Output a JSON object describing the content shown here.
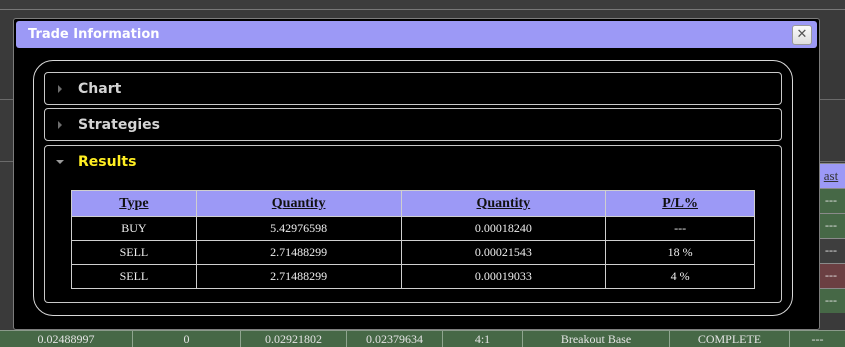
{
  "dialog": {
    "title": "Trade Information",
    "close_glyph": "✕"
  },
  "sections": {
    "chart": "Chart",
    "strategies": "Strategies",
    "results": "Results"
  },
  "results_table": {
    "headers": [
      "Type",
      "Quantity",
      "Quantity",
      "P/L%"
    ],
    "rows": [
      [
        "BUY",
        "5.42976598",
        "0.00018240",
        "---"
      ],
      [
        "SELL",
        "2.71488299",
        "0.00021543",
        "18 %"
      ],
      [
        "SELL",
        "2.71488299",
        "0.00019033",
        "4 %"
      ]
    ]
  },
  "background": {
    "right_header": "ast",
    "right_dashes": [
      "---",
      "---",
      "---",
      "---",
      "---",
      "---"
    ],
    "bottom_row": [
      "0.02488997",
      "0",
      "0.02921802",
      "0.02379634",
      "4:1",
      "Breakout Base",
      "COMPLETE",
      "---"
    ]
  },
  "colors": {
    "title_bar": "#9c99f6",
    "table_header": "#9c99f6",
    "active_section_label": "#ffee22",
    "row_green": "#466846",
    "row_red": "#6b3f42"
  },
  "icons": {
    "collapsed": "triangle-right-icon",
    "expanded": "triangle-down-icon",
    "close": "close-icon"
  }
}
